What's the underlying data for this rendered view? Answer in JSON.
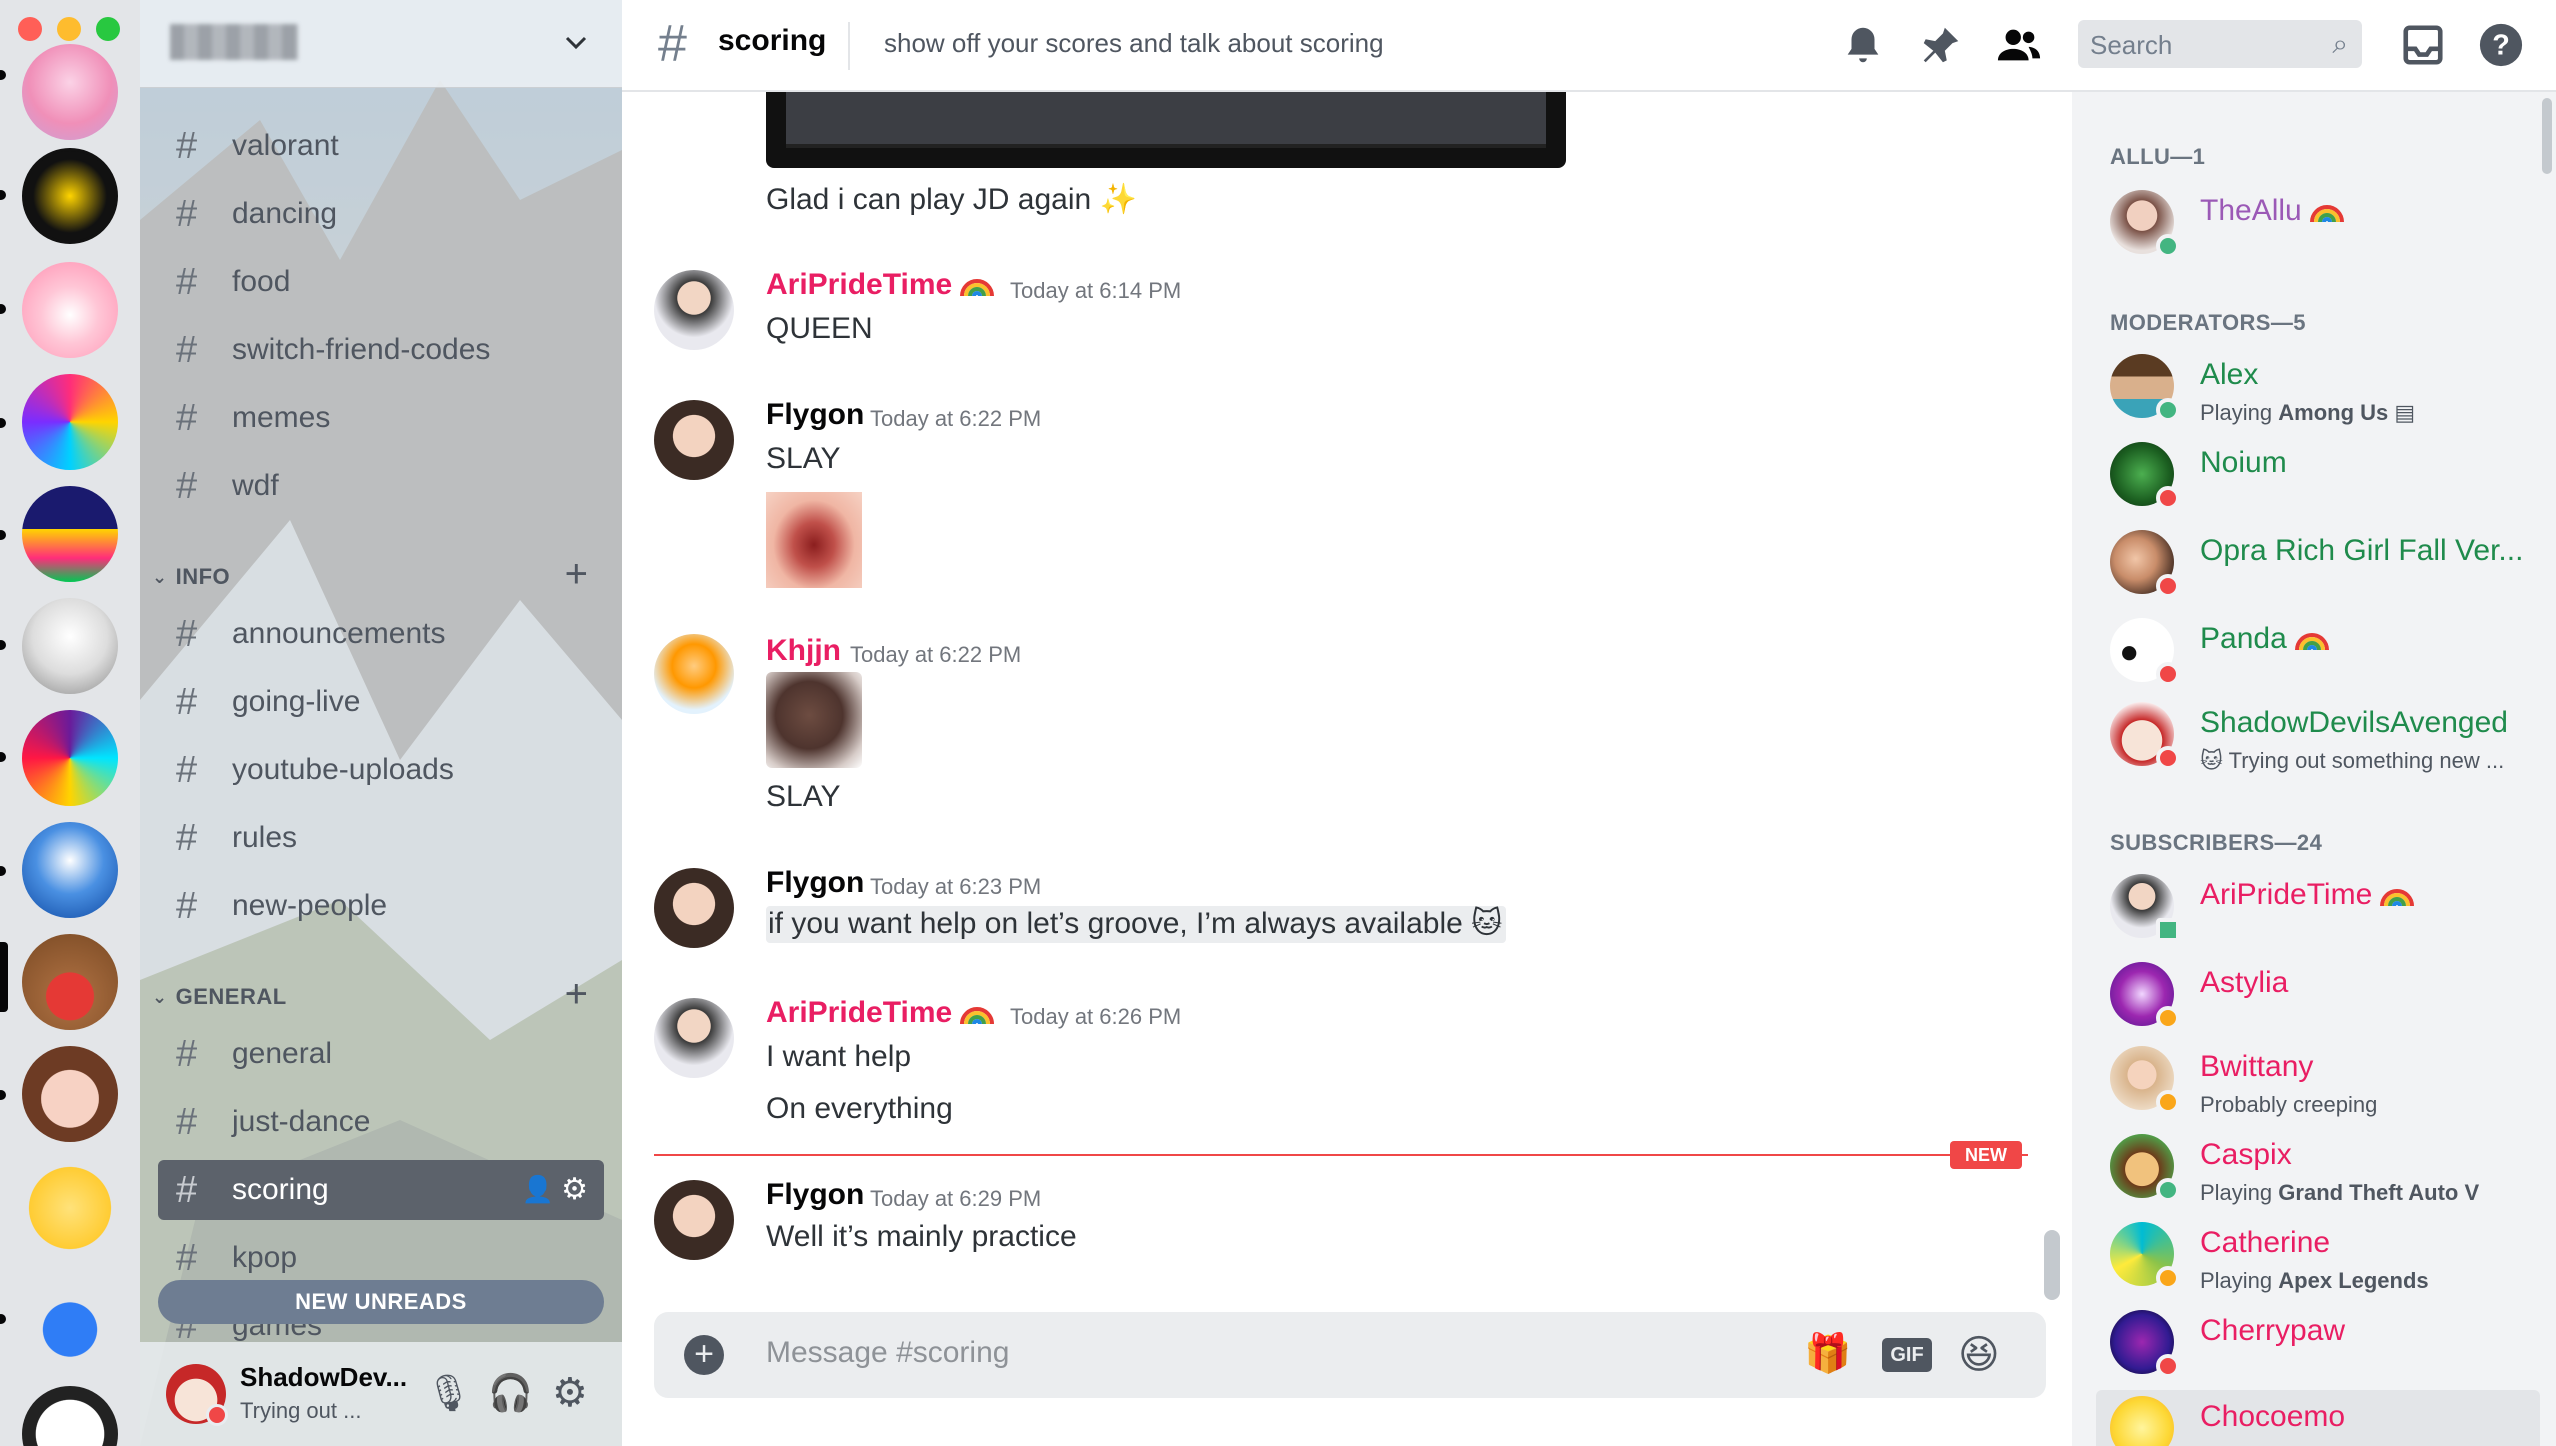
{
  "window": {
    "traffic_colors": [
      "#ff5f57",
      "#febc2e",
      "#28c840"
    ]
  },
  "server": {
    "name_blurred": true
  },
  "channels": {
    "partial_top": [
      {
        "name": "valorant"
      },
      {
        "name": "dancing"
      },
      {
        "name": "food"
      },
      {
        "name": "switch-friend-codes"
      },
      {
        "name": "memes"
      },
      {
        "name": "wdf"
      }
    ],
    "info": {
      "label": "INFO",
      "items": [
        {
          "name": "announcements"
        },
        {
          "name": "going-live"
        },
        {
          "name": "youtube-uploads"
        },
        {
          "name": "rules"
        },
        {
          "name": "new-people"
        }
      ]
    },
    "general": {
      "label": "GENERAL",
      "items": [
        {
          "name": "general"
        },
        {
          "name": "just-dance"
        },
        {
          "name": "scoring"
        },
        {
          "name": "kpop"
        },
        {
          "name": "games"
        }
      ]
    },
    "new_unreads": "NEW UNREADS"
  },
  "user_panel": {
    "name": "ShadowDev...",
    "status": "Trying out ..."
  },
  "header": {
    "channel": "scoring",
    "topic": "show off your scores and talk about scoring",
    "search_placeholder": "Search"
  },
  "messages": [
    {
      "text": "Glad i can play JD again"
    },
    {
      "author": "AriPrideTime",
      "time": "Today at 6:14 PM",
      "lines": [
        "QUEEN"
      ]
    },
    {
      "author": "Flygon",
      "time": "Today at 6:22 PM",
      "lines": [
        "SLAY"
      ]
    },
    {
      "author": "Khjjn",
      "time": "Today at 6:22 PM",
      "lines": [
        "SLAY"
      ]
    },
    {
      "author": "Flygon",
      "time": "Today at 6:23 PM",
      "lines": [
        "if you want help on let’s groove, I’m always available"
      ]
    },
    {
      "author": "AriPrideTime",
      "time": "Today at 6:26 PM",
      "lines": [
        "I want help",
        "On everything"
      ]
    },
    {
      "author": "Flygon",
      "time": "Today at 6:29 PM",
      "lines": [
        "Well it’s mainly practice"
      ]
    }
  ],
  "new_tag": "NEW",
  "composer": {
    "placeholder": "Message #scoring",
    "gif": "GIF"
  },
  "members": {
    "owner_cat": "ALLU—1",
    "mod_cat": "MODERATORS—5",
    "sub_cat": "SUBSCRIBERS—24",
    "owner": [
      {
        "name": "TheAllu"
      }
    ],
    "mods": [
      {
        "name": "Alex",
        "activity_prefix": "Playing ",
        "activity": "Among Us"
      },
      {
        "name": "Noium"
      },
      {
        "name": "Opra Rich Girl Fall Ver..."
      },
      {
        "name": "Panda"
      },
      {
        "name": "ShadowDevilsAvenged",
        "activity": "Trying out something new ..."
      }
    ],
    "subs": [
      {
        "name": "AriPrideTime"
      },
      {
        "name": "Astylia"
      },
      {
        "name": "Bwittany",
        "activity": "Probably creeping"
      },
      {
        "name": "Caspix",
        "activity_prefix": "Playing ",
        "activity": "Grand Theft Auto V"
      },
      {
        "name": "Catherine",
        "activity_prefix": "Playing ",
        "activity": "Apex Legends"
      },
      {
        "name": "Cherrypaw"
      },
      {
        "name": "Chocoemo"
      }
    ]
  },
  "colors": {
    "online": "#43b581",
    "dnd": "#f04747",
    "idle": "#faa61a",
    "pink": "#e91e63",
    "mod_green": "#1f8b4c",
    "owner_purple": "#9b59b6",
    "new_red": "#f04747"
  }
}
